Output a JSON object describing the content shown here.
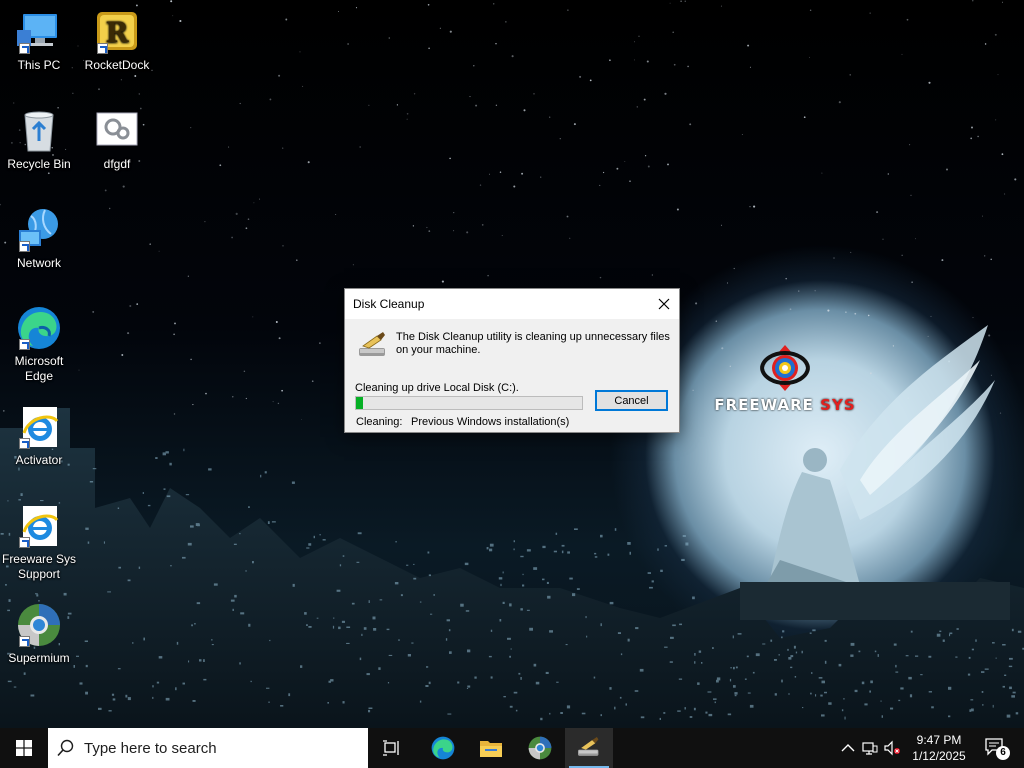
{
  "desktop": {
    "icons": [
      {
        "label": "This PC",
        "icon": "this-pc-icon"
      },
      {
        "label": "RocketDock",
        "icon": "rocketdock-icon"
      },
      {
        "label": "Recycle Bin",
        "icon": "recycle-bin-icon"
      },
      {
        "label": "dfgdf",
        "icon": "settings-file-icon"
      },
      {
        "label": "Network",
        "icon": "network-icon"
      },
      {
        "label": "Microsoft Edge",
        "icon": "edge-icon"
      },
      {
        "label": "Activator",
        "icon": "internet-explorer-icon"
      },
      {
        "label": "Freeware Sys Support",
        "icon": "internet-explorer-icon"
      },
      {
        "label": "Supermium",
        "icon": "supermium-icon"
      }
    ],
    "wallpaper_logo": {
      "brand_white": "FREEWARE",
      "brand_red": "SYS"
    }
  },
  "dialog": {
    "title": "Disk Cleanup",
    "message": "The Disk Cleanup utility is cleaning up unnecessary files on your machine.",
    "drive_status": "Cleaning up drive Local Disk (C:).",
    "progress": 0.03,
    "cancel_label": "Cancel",
    "cleaning_label": "Cleaning:",
    "cleaning_item": "Previous Windows installation(s)"
  },
  "taskbar": {
    "search_placeholder": "Type here to search",
    "time": "9:47 PM",
    "date": "1/12/2025",
    "notification_count": "6",
    "pinned": [
      "edge-icon",
      "file-explorer-icon",
      "supermium-icon",
      "disk-cleanup-icon"
    ]
  },
  "colors": {
    "accent": "#0078d7",
    "progress_fill": "#06b025",
    "taskbar": "#101010"
  }
}
